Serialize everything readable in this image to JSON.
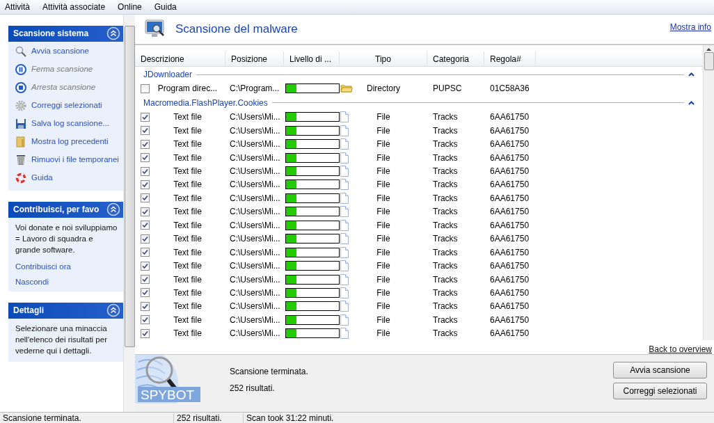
{
  "menu": [
    "Attività",
    "Attività associate",
    "Online",
    "Guida"
  ],
  "side_panels": [
    {
      "title": "Scansione sistema",
      "expanded": true,
      "items": [
        {
          "label": "Avvia scansione",
          "disabled": false
        },
        {
          "label": "Ferma scansione",
          "disabled": true
        },
        {
          "label": "Arresta scansione",
          "disabled": true
        },
        {
          "label": "Correggi selezionati",
          "disabled": false
        },
        {
          "label": "Salva log scansione...",
          "disabled": false
        },
        {
          "label": "Mostra log precedenti",
          "disabled": false
        },
        {
          "label": "Rimuovi i file temporanei",
          "disabled": false
        },
        {
          "label": "Guida",
          "disabled": false
        }
      ]
    },
    {
      "title": "Contribuisci, per favo",
      "expanded": true,
      "text": "Voi donate e noi sviluppiamo = Lavoro di squadra e grande software.",
      "links": [
        "Contribuisci ora",
        "Nascondi"
      ]
    },
    {
      "title": "Dettagli",
      "expanded": true,
      "text": "Selezionare una minaccia nell'elenco dei risultati per vederne qui i dettagli."
    }
  ],
  "main": {
    "title": "Scansione del malware",
    "info_link": "Mostra info",
    "columns": [
      "Descrizione",
      "Posizione",
      "Livello di ...",
      "Tipo",
      "Categoria",
      "Regola#"
    ],
    "groups": [
      {
        "name": "JDownloader",
        "expanded": true,
        "rows": [
          {
            "checked": false,
            "description": "Program direc...",
            "location": "C:\\Program...",
            "level": 0.2,
            "kind": "folder",
            "type": "Directory",
            "category": "PUPSC",
            "rule": "01C58A36"
          }
        ]
      },
      {
        "name": "Macromedia.FlashPlayer.Cookies",
        "expanded": true,
        "rows": [
          {
            "checked": true,
            "description": "Text file",
            "location": "C:\\Users\\Mi...",
            "level": 0.2,
            "kind": "file",
            "type": "File",
            "category": "Tracks",
            "rule": "6AA61750"
          },
          {
            "checked": true,
            "description": "Text file",
            "location": "C:\\Users\\Mi...",
            "level": 0.2,
            "kind": "file",
            "type": "File",
            "category": "Tracks",
            "rule": "6AA61750"
          },
          {
            "checked": true,
            "description": "Text file",
            "location": "C:\\Users\\Mi...",
            "level": 0.2,
            "kind": "file",
            "type": "File",
            "category": "Tracks",
            "rule": "6AA61750"
          },
          {
            "checked": true,
            "description": "Text file",
            "location": "C:\\Users\\Mi...",
            "level": 0.2,
            "kind": "file",
            "type": "File",
            "category": "Tracks",
            "rule": "6AA61750"
          },
          {
            "checked": true,
            "description": "Text file",
            "location": "C:\\Users\\Mi...",
            "level": 0.2,
            "kind": "file",
            "type": "File",
            "category": "Tracks",
            "rule": "6AA61750"
          },
          {
            "checked": true,
            "description": "Text file",
            "location": "C:\\Users\\Mi...",
            "level": 0.2,
            "kind": "file",
            "type": "File",
            "category": "Tracks",
            "rule": "6AA61750"
          },
          {
            "checked": true,
            "description": "Text file",
            "location": "C:\\Users\\Mi...",
            "level": 0.2,
            "kind": "file",
            "type": "File",
            "category": "Tracks",
            "rule": "6AA61750"
          },
          {
            "checked": true,
            "description": "Text file",
            "location": "C:\\Users\\Mi...",
            "level": 0.2,
            "kind": "file",
            "type": "File",
            "category": "Tracks",
            "rule": "6AA61750"
          },
          {
            "checked": true,
            "description": "Text file",
            "location": "C:\\Users\\Mi...",
            "level": 0.2,
            "kind": "file",
            "type": "File",
            "category": "Tracks",
            "rule": "6AA61750"
          },
          {
            "checked": true,
            "description": "Text file",
            "location": "C:\\Users\\Mi...",
            "level": 0.2,
            "kind": "file",
            "type": "File",
            "category": "Tracks",
            "rule": "6AA61750"
          },
          {
            "checked": true,
            "description": "Text file",
            "location": "C:\\Users\\Mi...",
            "level": 0.2,
            "kind": "file",
            "type": "File",
            "category": "Tracks",
            "rule": "6AA61750"
          },
          {
            "checked": true,
            "description": "Text file",
            "location": "C:\\Users\\Mi...",
            "level": 0.2,
            "kind": "file",
            "type": "File",
            "category": "Tracks",
            "rule": "6AA61750"
          },
          {
            "checked": true,
            "description": "Text file",
            "location": "C:\\Users\\Mi...",
            "level": 0.2,
            "kind": "file",
            "type": "File",
            "category": "Tracks",
            "rule": "6AA61750"
          },
          {
            "checked": true,
            "description": "Text file",
            "location": "C:\\Users\\Mi...",
            "level": 0.2,
            "kind": "file",
            "type": "File",
            "category": "Tracks",
            "rule": "6AA61750"
          },
          {
            "checked": true,
            "description": "Text file",
            "location": "C:\\Users\\Mi...",
            "level": 0.2,
            "kind": "file",
            "type": "File",
            "category": "Tracks",
            "rule": "6AA61750"
          },
          {
            "checked": true,
            "description": "Text file",
            "location": "C:\\Users\\Mi...",
            "level": 0.2,
            "kind": "file",
            "type": "File",
            "category": "Tracks",
            "rule": "6AA61750"
          },
          {
            "checked": true,
            "description": "Text file",
            "location": "C:\\Users\\Mi...",
            "level": 0.2,
            "kind": "file",
            "type": "File",
            "category": "Tracks",
            "rule": "6AA61750"
          }
        ]
      }
    ],
    "back_link": "Back to overview",
    "logo": "SPYBOT",
    "status_lines": [
      "Scansione terminata.",
      "252 risultati."
    ],
    "buttons": [
      "Avvia scansione",
      "Correggi selezionati"
    ]
  },
  "status_bar": [
    "Scansione terminata.",
    "252 risultati.",
    "Scan took 31:22 minuti."
  ]
}
